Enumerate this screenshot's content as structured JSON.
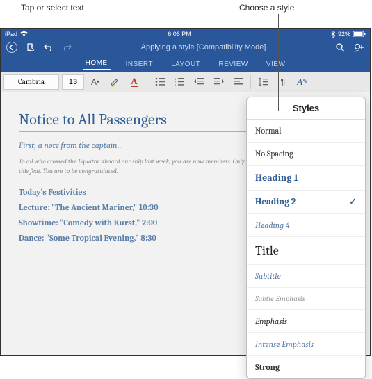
{
  "annotations": {
    "left": "Tap or select text",
    "right": "Choose a style"
  },
  "status": {
    "device": "iPad",
    "wifi": "◒",
    "time": "6:06 PM",
    "bluetooth": "$ 92%",
    "battery_percent": "92%"
  },
  "titlebar": {
    "back": "←",
    "pin": "↪",
    "undo": "↶",
    "redo": "↷",
    "doc_title": "Applying a style [Compatibility Mode]",
    "search": "🔍",
    "share": "☺"
  },
  "tabs": [
    {
      "label": "HOME",
      "active": true
    },
    {
      "label": "INSERT",
      "active": false
    },
    {
      "label": "LAYOUT",
      "active": false
    },
    {
      "label": "REVIEW",
      "active": false
    },
    {
      "label": "VIEW",
      "active": false
    }
  ],
  "toolbar": {
    "font_name": "Cambria",
    "font_size": "13",
    "btn_fontsize_ext": "A˅",
    "btn_highlight": "✎",
    "btn_fontcolor": "A",
    "btn_bullets": "•—",
    "btn_numbers": "☰",
    "btn_deindent": "⇤",
    "btn_indent": "⇥",
    "btn_align": "≡",
    "btn_linespace": "↕≡",
    "btn_pilcrow": "¶",
    "btn_styles": "A✎"
  },
  "doc": {
    "heading": "Notice to All Passengers",
    "subtitle": "First, a note from the captain…",
    "body": "To all who crossed the Equator aboard our ship last week, you are now members. Only a few landlubbers have accomplished this feat. You are to be congratulated.",
    "section": "Today's Festivities",
    "event1a": "Lecture: \"The Ancient Mariner,\" ",
    "event1b": "10:30",
    "event2": "Showtime: \"Comedy with Kurst,\" 2:00",
    "event3": "Dance: \"Some Tropical Evening,\" 8:30"
  },
  "styles_popover": {
    "title": "Styles",
    "items": [
      {
        "label": "Normal",
        "cls": "sr-normal",
        "selected": false
      },
      {
        "label": "No Spacing",
        "cls": "sr-normal",
        "selected": false
      },
      {
        "label": "Heading 1",
        "cls": "sr-h1",
        "selected": false
      },
      {
        "label": "Heading 2",
        "cls": "sr-h2",
        "selected": true
      },
      {
        "label": "Heading 4",
        "cls": "sr-h4",
        "selected": false
      },
      {
        "label": "Title",
        "cls": "sr-title",
        "selected": false
      },
      {
        "label": "Subtitle",
        "cls": "sr-subtitle",
        "selected": false
      },
      {
        "label": "Subtle Emphasis",
        "cls": "sr-subtle",
        "selected": false
      },
      {
        "label": "Emphasis",
        "cls": "sr-emph",
        "selected": false
      },
      {
        "label": "Intense Emphasis",
        "cls": "sr-intense",
        "selected": false
      },
      {
        "label": "Strong",
        "cls": "sr-strong",
        "selected": false
      }
    ]
  }
}
